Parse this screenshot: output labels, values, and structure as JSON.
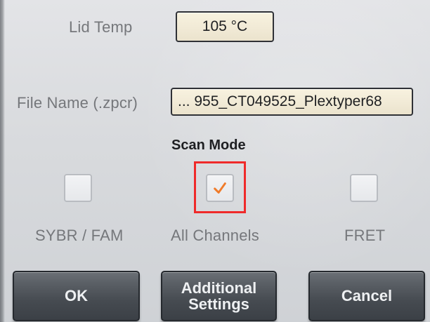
{
  "lid_temp": {
    "label": "Lid Temp",
    "value": "105 °C"
  },
  "file_name": {
    "label": "File Name (.zpcr)",
    "value": "... 955_CT049525_Plextyper68"
  },
  "scan_mode": {
    "title": "Scan Mode",
    "options": [
      {
        "label": "SYBR / FAM",
        "checked": false
      },
      {
        "label": "All Channels",
        "checked": true
      },
      {
        "label": "FRET",
        "checked": false
      }
    ]
  },
  "buttons": {
    "ok": "OK",
    "additional_settings": "Additional\nSettings",
    "cancel": "Cancel"
  },
  "colors": {
    "check": "#f07b2a",
    "highlight": "#ef2a2a"
  },
  "icons": {
    "checkmark": "check-icon"
  }
}
